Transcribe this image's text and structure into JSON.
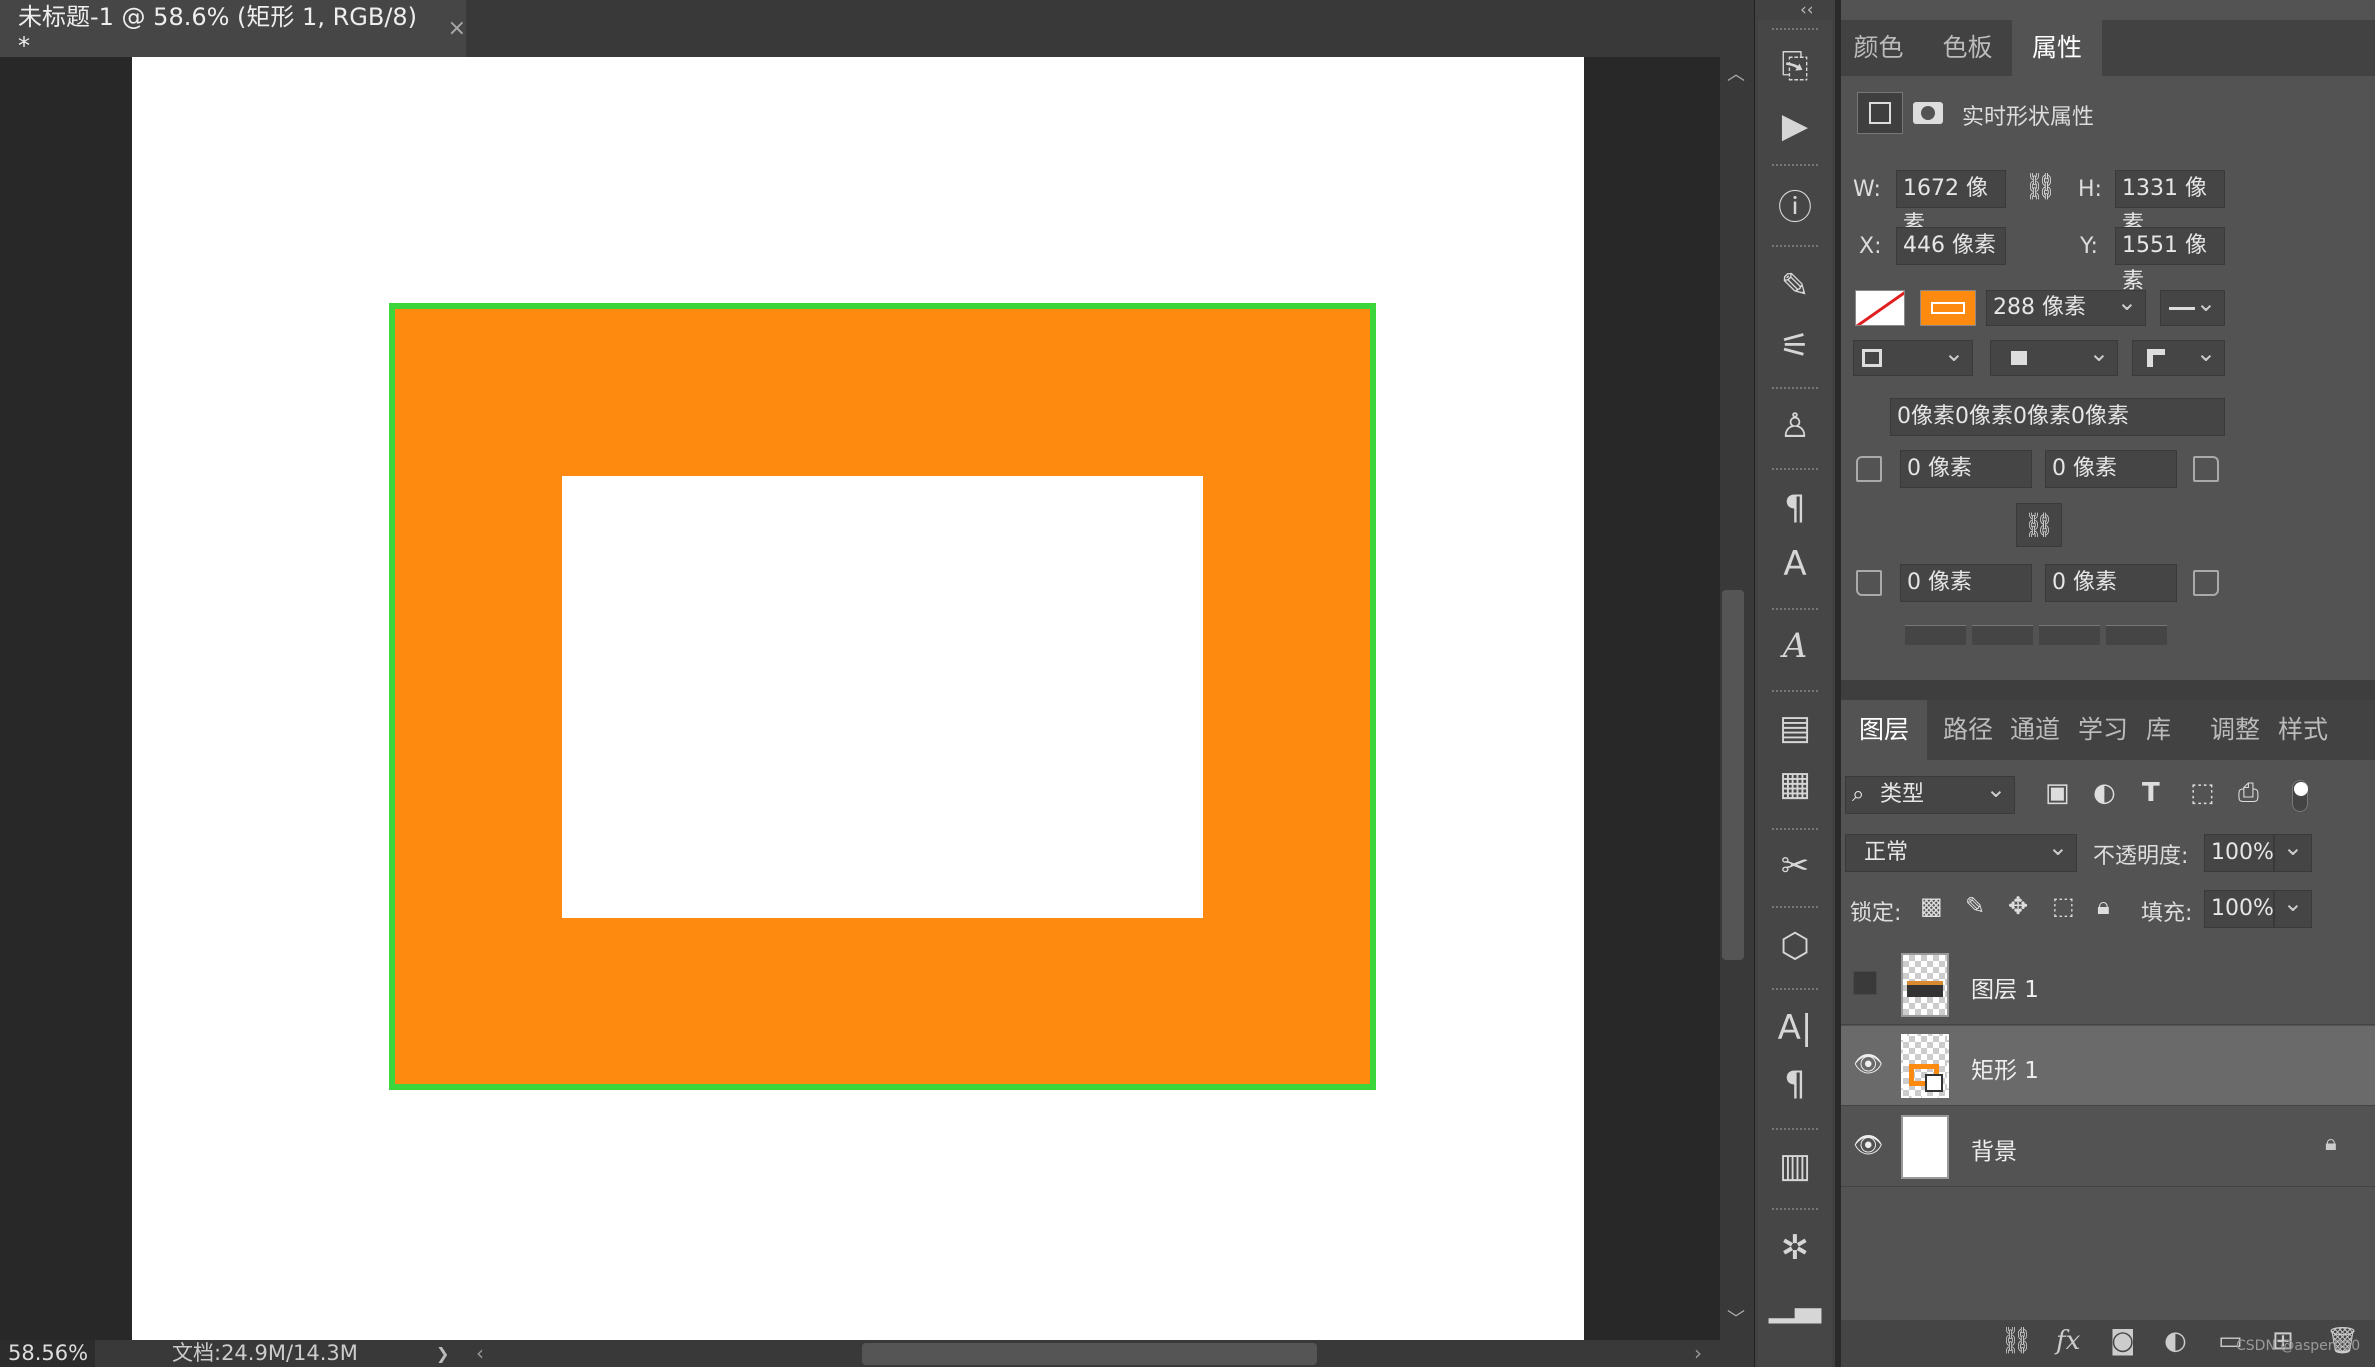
{
  "document": {
    "tab_title": "未标题-1 @ 58.6% (矩形 1, RGB/8) *",
    "close_glyph": "×",
    "zoom": "58.56%",
    "doc_info": "文档:24.9M/14.3M",
    "status_arrow": "❯",
    "canvas_colors": {
      "fill": "#fe8a0f",
      "stroke": "#3cd53c",
      "background": "#ffffff"
    }
  },
  "toolstrip": {
    "collapse": "‹‹",
    "icons": [
      "history-icon",
      "play-icon",
      "info-icon",
      "brush-settings-icon",
      "adjust-icon",
      "clone-source-icon",
      "paragraph-style-icon",
      "character-style-icon",
      "glyphs-icon",
      "notes-icon",
      "comment-icon",
      "tool-presets-icon",
      "3d-icon",
      "character-icon",
      "paragraph-icon",
      "timeline-icon",
      "navigator-icon",
      "histogram-icon"
    ]
  },
  "properties": {
    "tabs": [
      "颜色",
      "色板",
      "属性"
    ],
    "active_tab": "属性",
    "header": "实时形状属性",
    "w_label": "W:",
    "w_value": "1672 像素",
    "h_label": "H:",
    "h_value": "1331 像素",
    "x_label": "X:",
    "x_value": "446 像素",
    "y_label": "Y:",
    "y_value": "1551 像素",
    "stroke_width": "288 像素",
    "stroke_color": "#fe8a0f",
    "corner_summary": "0像素0像素0像素0像素",
    "corner_tl": "0 像素",
    "corner_tr": "0 像素",
    "corner_bl": "0 像素",
    "corner_br": "0 像素"
  },
  "layers": {
    "tabs": [
      "图层",
      "路径",
      "通道",
      "学习",
      "库",
      "调整",
      "样式"
    ],
    "active_tab": "图层",
    "filter": "类型",
    "blend_mode": "正常",
    "opacity_label": "不透明度:",
    "opacity": "100%",
    "lock_label": "锁定:",
    "fill_label": "填充:",
    "fill": "100%",
    "items": [
      {
        "name": "图层 1",
        "visible": false,
        "selected": false
      },
      {
        "name": "矩形 1",
        "visible": true,
        "selected": true
      },
      {
        "name": "背景",
        "visible": true,
        "selected": false,
        "locked": true
      }
    ],
    "watermark": "CSDN @asper000"
  }
}
